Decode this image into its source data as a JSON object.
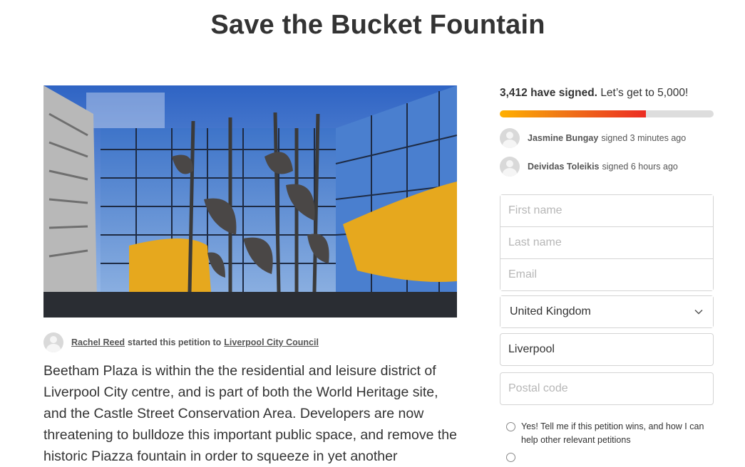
{
  "page": {
    "title": "Save the Bucket Fountain"
  },
  "starter": {
    "name": "Rachel Reed",
    "text": "started this petition to",
    "target": "Liverpool City Council"
  },
  "body": {
    "text": "Beetham Plaza is within the the residential and leisure district of Liverpool City centre, and is part of both the World Heritage site, and the Castle Street Conservation Area.  Developers are now threatening to bulldoze this important public space, and remove the historic Piazza fountain in order to squeeze in yet another"
  },
  "progress": {
    "count": "3,412 have signed.",
    "goal_text": "Let’s get to 5,000!",
    "fraction": 0.6824,
    "colors": {
      "start": "#ffb000",
      "end": "#ec2c22",
      "track": "#dddddd"
    }
  },
  "recent_signers": [
    {
      "name": "Jasmine Bungay",
      "action": "signed 3 minutes ago"
    },
    {
      "name": "Deividas Toleikis",
      "action": "signed 6 hours ago"
    }
  ],
  "form": {
    "first_name_placeholder": "First name",
    "last_name_placeholder": "Last name",
    "email_placeholder": "Email",
    "country": "United Kingdom",
    "city": "Liverpool",
    "postal_placeholder": "Postal code",
    "optin_label": "Yes! Tell me if this petition wins, and how I can help other relevant petitions"
  },
  "icons": {
    "avatar": "user-silhouette-icon",
    "dropdown": "chevron-down-icon"
  }
}
